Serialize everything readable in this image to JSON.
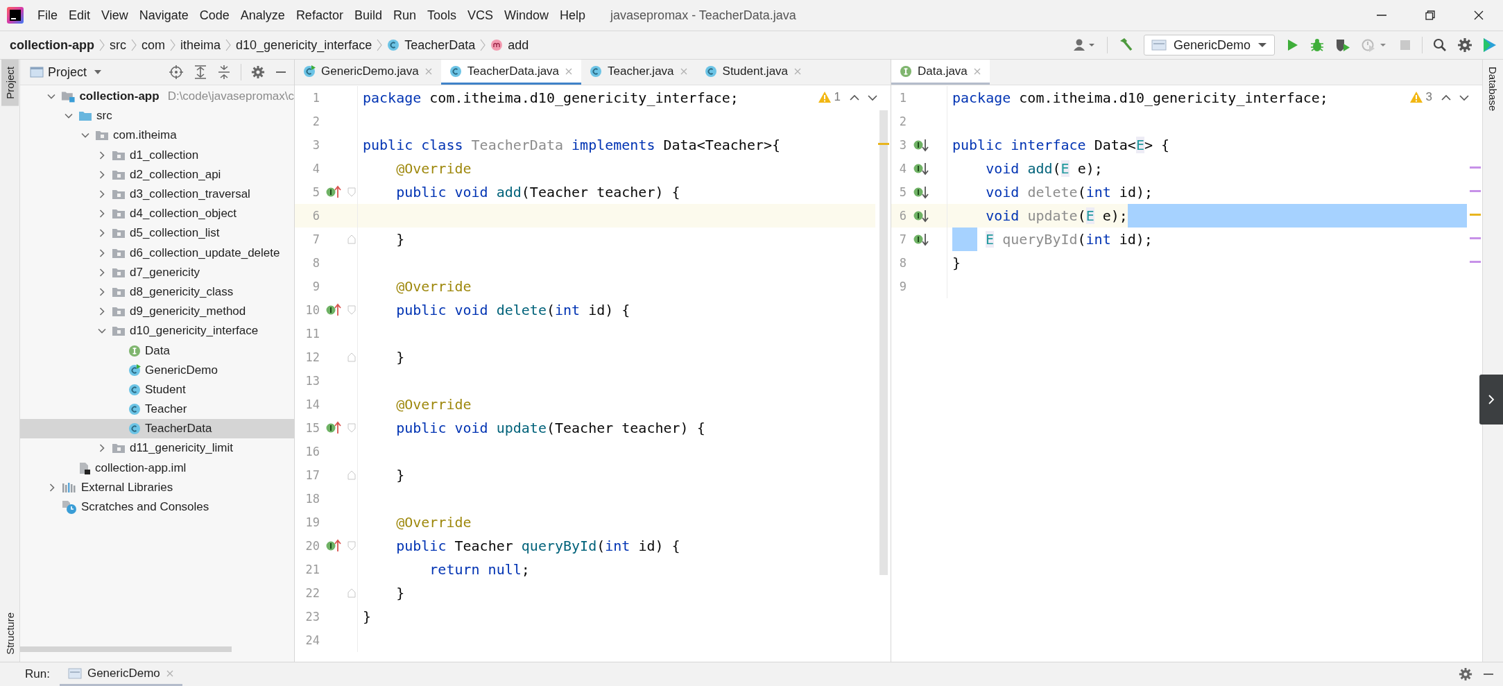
{
  "window": {
    "title": "javasepromax - TeacherData.java"
  },
  "menu": [
    "File",
    "Edit",
    "View",
    "Navigate",
    "Code",
    "Analyze",
    "Refactor",
    "Build",
    "Run",
    "Tools",
    "VCS",
    "Window",
    "Help"
  ],
  "breadcrumbs": [
    {
      "label": "collection-app",
      "kind": "project"
    },
    {
      "label": "src",
      "kind": "dir"
    },
    {
      "label": "com",
      "kind": "dir"
    },
    {
      "label": "itheima",
      "kind": "dir"
    },
    {
      "label": "d10_genericity_interface",
      "kind": "dir"
    },
    {
      "label": "TeacherData",
      "kind": "class"
    },
    {
      "label": "add",
      "kind": "method"
    }
  ],
  "toolbar": {
    "run_config": "GenericDemo"
  },
  "side_tabs_left": [
    {
      "label": "Project",
      "selected": true
    },
    {
      "label": "Structure",
      "selected": false
    }
  ],
  "side_tabs_right": [
    {
      "label": "Database",
      "selected": false
    }
  ],
  "project_panel": {
    "title": "Project",
    "tree": [
      {
        "label": "collection-app",
        "kind": "module",
        "hint": "D:\\code\\javasepromax\\c",
        "expanded": true,
        "selected": false,
        "children": [
          {
            "label": "src",
            "kind": "src",
            "expanded": true,
            "selected": false,
            "children": [
              {
                "label": "com.itheima",
                "kind": "package",
                "expanded": true,
                "selected": false,
                "children": [
                  {
                    "label": "d1_collection",
                    "kind": "package",
                    "expanded": false,
                    "selected": false
                  },
                  {
                    "label": "d2_collection_api",
                    "kind": "package",
                    "expanded": false,
                    "selected": false
                  },
                  {
                    "label": "d3_collection_traversal",
                    "kind": "package",
                    "expanded": false,
                    "selected": false
                  },
                  {
                    "label": "d4_collection_object",
                    "kind": "package",
                    "expanded": false,
                    "selected": false
                  },
                  {
                    "label": "d5_collection_list",
                    "kind": "package",
                    "expanded": false,
                    "selected": false
                  },
                  {
                    "label": "d6_collection_update_delete",
                    "kind": "package",
                    "expanded": false,
                    "selected": false
                  },
                  {
                    "label": "d7_genericity",
                    "kind": "package",
                    "expanded": false,
                    "selected": false
                  },
                  {
                    "label": "d8_genericity_class",
                    "kind": "package",
                    "expanded": false,
                    "selected": false
                  },
                  {
                    "label": "d9_genericity_method",
                    "kind": "package",
                    "expanded": false,
                    "selected": false
                  },
                  {
                    "label": "d10_genericity_interface",
                    "kind": "package",
                    "expanded": true,
                    "selected": false,
                    "children": [
                      {
                        "label": "Data",
                        "kind": "interface",
                        "selected": false
                      },
                      {
                        "label": "GenericDemo",
                        "kind": "class-run",
                        "selected": false
                      },
                      {
                        "label": "Student",
                        "kind": "class",
                        "selected": false
                      },
                      {
                        "label": "Teacher",
                        "kind": "class",
                        "selected": false
                      },
                      {
                        "label": "TeacherData",
                        "kind": "class",
                        "selected": true
                      }
                    ]
                  },
                  {
                    "label": "d11_genericity_limit",
                    "kind": "package",
                    "expanded": false,
                    "selected": false
                  }
                ]
              }
            ]
          },
          {
            "label": "collection-app.iml",
            "kind": "iml",
            "selected": false
          }
        ]
      },
      {
        "label": "External Libraries",
        "kind": "libraries",
        "expanded": false,
        "selected": false
      },
      {
        "label": "Scratches and Consoles",
        "kind": "scratches",
        "selected": false
      }
    ]
  },
  "editors": [
    {
      "focused": true,
      "warnings": "1",
      "tabs": [
        {
          "label": "GenericDemo.java",
          "kind": "class-run",
          "selected": false
        },
        {
          "label": "TeacherData.java",
          "kind": "class",
          "selected": true
        },
        {
          "label": "Teacher.java",
          "kind": "class",
          "selected": false
        },
        {
          "label": "Student.java",
          "kind": "class",
          "selected": false
        }
      ],
      "lines": [
        {
          "n": "1",
          "tokens": [
            {
              "text": "package ",
              "kind": "kw"
            },
            {
              "text": "com.itheima.d10_genericity_interface;",
              "kind": "p"
            }
          ]
        },
        {
          "n": "2"
        },
        {
          "n": "3",
          "tokens": [
            {
              "text": "public class ",
              "kind": "kw"
            },
            {
              "text": "TeacherData",
              "kind": "gray"
            },
            {
              "text": " implements ",
              "kind": "kw"
            },
            {
              "text": "Data<Teacher>{",
              "kind": "p"
            }
          ]
        },
        {
          "n": "4",
          "tokens": [
            {
              "text": "    @Override",
              "kind": "ann"
            }
          ]
        },
        {
          "n": "5",
          "gutter": {
            "kind": "up"
          },
          "fold": {
            "kind": "start"
          },
          "tokens": [
            {
              "text": "    public void ",
              "kind": "kw"
            },
            {
              "text": "add",
              "kind": "fn"
            },
            {
              "text": "(Teacher teacher) {",
              "kind": "p"
            }
          ]
        },
        {
          "n": "6",
          "current": true
        },
        {
          "n": "7",
          "fold": {
            "kind": "end"
          },
          "tokens": [
            {
              "text": "    }",
              "kind": "p"
            }
          ]
        },
        {
          "n": "8"
        },
        {
          "n": "9",
          "tokens": [
            {
              "text": "    @Override",
              "kind": "ann"
            }
          ]
        },
        {
          "n": "10",
          "gutter": {
            "kind": "up"
          },
          "fold": {
            "kind": "start"
          },
          "tokens": [
            {
              "text": "    public void ",
              "kind": "kw"
            },
            {
              "text": "delete",
              "kind": "fn"
            },
            {
              "text": "(",
              "kind": "p"
            },
            {
              "text": "int ",
              "kind": "kw"
            },
            {
              "text": "id) {",
              "kind": "p"
            }
          ]
        },
        {
          "n": "11"
        },
        {
          "n": "12",
          "fold": {
            "kind": "end"
          },
          "tokens": [
            {
              "text": "    }",
              "kind": "p"
            }
          ]
        },
        {
          "n": "13"
        },
        {
          "n": "14",
          "tokens": [
            {
              "text": "    @Override",
              "kind": "ann"
            }
          ]
        },
        {
          "n": "15",
          "gutter": {
            "kind": "up"
          },
          "fold": {
            "kind": "start"
          },
          "tokens": [
            {
              "text": "    public void ",
              "kind": "kw"
            },
            {
              "text": "update",
              "kind": "fn"
            },
            {
              "text": "(Teacher teacher) {",
              "kind": "p"
            }
          ]
        },
        {
          "n": "16"
        },
        {
          "n": "17",
          "fold": {
            "kind": "end"
          },
          "tokens": [
            {
              "text": "    }",
              "kind": "p"
            }
          ]
        },
        {
          "n": "18"
        },
        {
          "n": "19",
          "tokens": [
            {
              "text": "    @Override",
              "kind": "ann"
            }
          ]
        },
        {
          "n": "20",
          "gutter": {
            "kind": "up"
          },
          "fold": {
            "kind": "start"
          },
          "tokens": [
            {
              "text": "    public ",
              "kind": "kw"
            },
            {
              "text": "Teacher ",
              "kind": "p"
            },
            {
              "text": "queryById",
              "kind": "fn"
            },
            {
              "text": "(",
              "kind": "p"
            },
            {
              "text": "int ",
              "kind": "kw"
            },
            {
              "text": "id) {",
              "kind": "p"
            }
          ]
        },
        {
          "n": "21",
          "tokens": [
            {
              "text": "        return null",
              "kind": "kw"
            },
            {
              "text": ";",
              "kind": "p"
            }
          ]
        },
        {
          "n": "22",
          "fold": {
            "kind": "end"
          },
          "tokens": [
            {
              "text": "    }",
              "kind": "p"
            }
          ]
        },
        {
          "n": "23",
          "tokens": [
            {
              "text": "}",
              "kind": "p"
            }
          ]
        },
        {
          "n": "24"
        }
      ]
    },
    {
      "focused": false,
      "warnings": "3",
      "tabs": [
        {
          "label": "Data.java",
          "kind": "interface",
          "selected": true
        }
      ],
      "lines": [
        {
          "n": "1",
          "tokens": [
            {
              "text": "package ",
              "kind": "kw"
            },
            {
              "text": "com.itheima.d10_genericity_interface;",
              "kind": "p"
            }
          ]
        },
        {
          "n": "2"
        },
        {
          "n": "3",
          "gutter": {
            "kind": "down"
          },
          "tokens": [
            {
              "text": "public interface ",
              "kind": "kw"
            },
            {
              "text": "Data<",
              "kind": "p"
            },
            {
              "text": "E",
              "kind": "tp"
            },
            {
              "text": "> {",
              "kind": "p"
            }
          ]
        },
        {
          "n": "4",
          "gutter": {
            "kind": "down"
          },
          "tokens": [
            {
              "text": "    void ",
              "kind": "kw"
            },
            {
              "text": "add",
              "kind": "fn"
            },
            {
              "text": "(",
              "kind": "p"
            },
            {
              "text": "E",
              "kind": "tp"
            },
            {
              "text": " e);",
              "kind": "p"
            }
          ]
        },
        {
          "n": "5",
          "gutter": {
            "kind": "down"
          },
          "tokens": [
            {
              "text": "    void ",
              "kind": "kw"
            },
            {
              "text": "delete",
              "kind": "gray"
            },
            {
              "text": "(",
              "kind": "p"
            },
            {
              "text": "int ",
              "kind": "kw"
            },
            {
              "text": "id);",
              "kind": "p"
            }
          ]
        },
        {
          "n": "6",
          "gutter": {
            "kind": "down"
          },
          "current": true,
          "sel_to_end": true,
          "tokens": [
            {
              "text": "    void ",
              "kind": "kw"
            },
            {
              "text": "update",
              "kind": "gray"
            },
            {
              "text": "(",
              "kind": "p"
            },
            {
              "text": "E",
              "kind": "tp"
            },
            {
              "text": " e);",
              "kind": "p"
            }
          ]
        },
        {
          "n": "7",
          "gutter": {
            "kind": "down"
          },
          "sel_indent": true,
          "tokens": [
            {
              "text": " E",
              "kind": "tp"
            },
            {
              "text": " queryById",
              "kind": "gray"
            },
            {
              "text": "(",
              "kind": "p"
            },
            {
              "text": "int ",
              "kind": "kw"
            },
            {
              "text": "id);",
              "kind": "p"
            }
          ]
        },
        {
          "n": "8",
          "tokens": [
            {
              "text": "}",
              "kind": "p"
            }
          ]
        },
        {
          "n": "9"
        }
      ]
    }
  ],
  "run_bar": {
    "label": "Run:",
    "tabs": [
      {
        "label": "GenericDemo",
        "selected": true
      }
    ]
  }
}
